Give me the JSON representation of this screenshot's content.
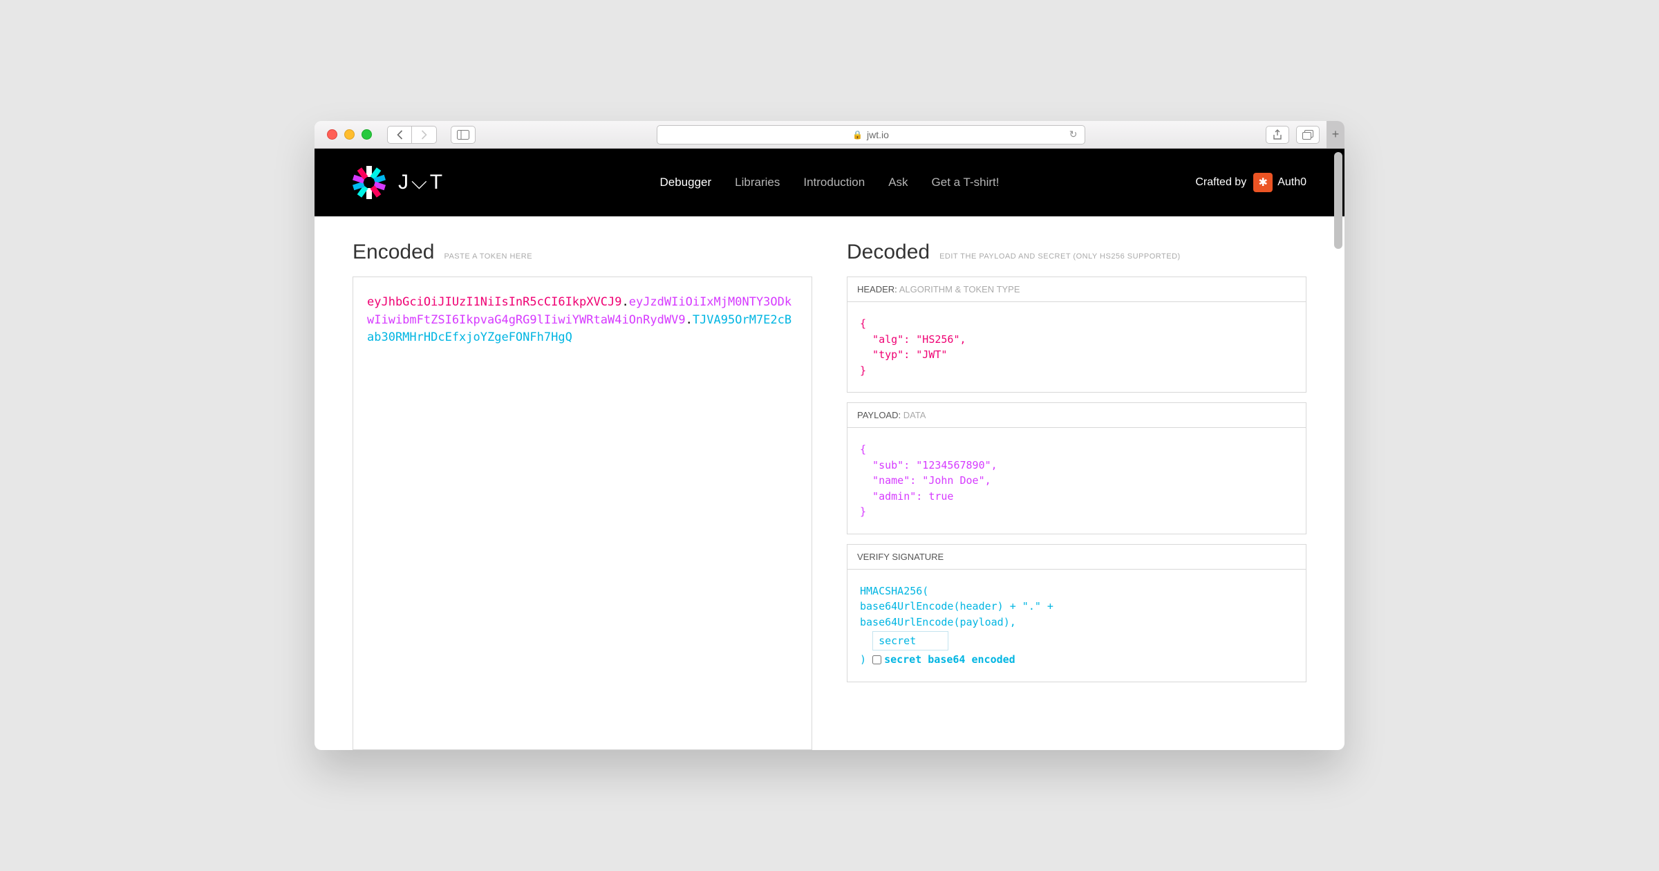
{
  "browser": {
    "url_host": "jwt.io"
  },
  "header": {
    "logo_text": "J⌵T",
    "nav": [
      "Debugger",
      "Libraries",
      "Introduction",
      "Ask",
      "Get a T-shirt!"
    ],
    "crafted_by": "Crafted by",
    "brand": "Auth0"
  },
  "encoded": {
    "title": "Encoded",
    "hint": "PASTE A TOKEN HERE",
    "token_header": "eyJhbGciOiJIUzI1NiIsInR5cCI6IkpXVCJ9",
    "token_payload": "eyJzdWIiOiIxMjM0NTY3ODkwIiwibmFtZSI6IkpvaG4gRG9lIiwiYWRtaW4iOnRydWV9",
    "token_sig": "TJVA95OrM7E2cBab30RMHrHDcEfxjoYZgeFONFh7HgQ"
  },
  "decoded": {
    "title": "Decoded",
    "hint": "EDIT THE PAYLOAD AND SECRET (ONLY HS256 SUPPORTED)",
    "sections": {
      "header": {
        "label": "HEADER:",
        "sub": "ALGORITHM & TOKEN TYPE",
        "body": "{\n  \"alg\": \"HS256\",\n  \"typ\": \"JWT\"\n}"
      },
      "payload": {
        "label": "PAYLOAD:",
        "sub": "DATA",
        "body": "{\n  \"sub\": \"1234567890\",\n  \"name\": \"John Doe\",\n  \"admin\": true\n}"
      },
      "signature": {
        "label": "VERIFY SIGNATURE",
        "line1": "HMACSHA256(",
        "line2": "  base64UrlEncode(header) + \".\" +",
        "line3": "  base64UrlEncode(payload),",
        "secret_value": "secret",
        "close": ")",
        "checkbox_label": "secret base64 encoded"
      }
    }
  }
}
